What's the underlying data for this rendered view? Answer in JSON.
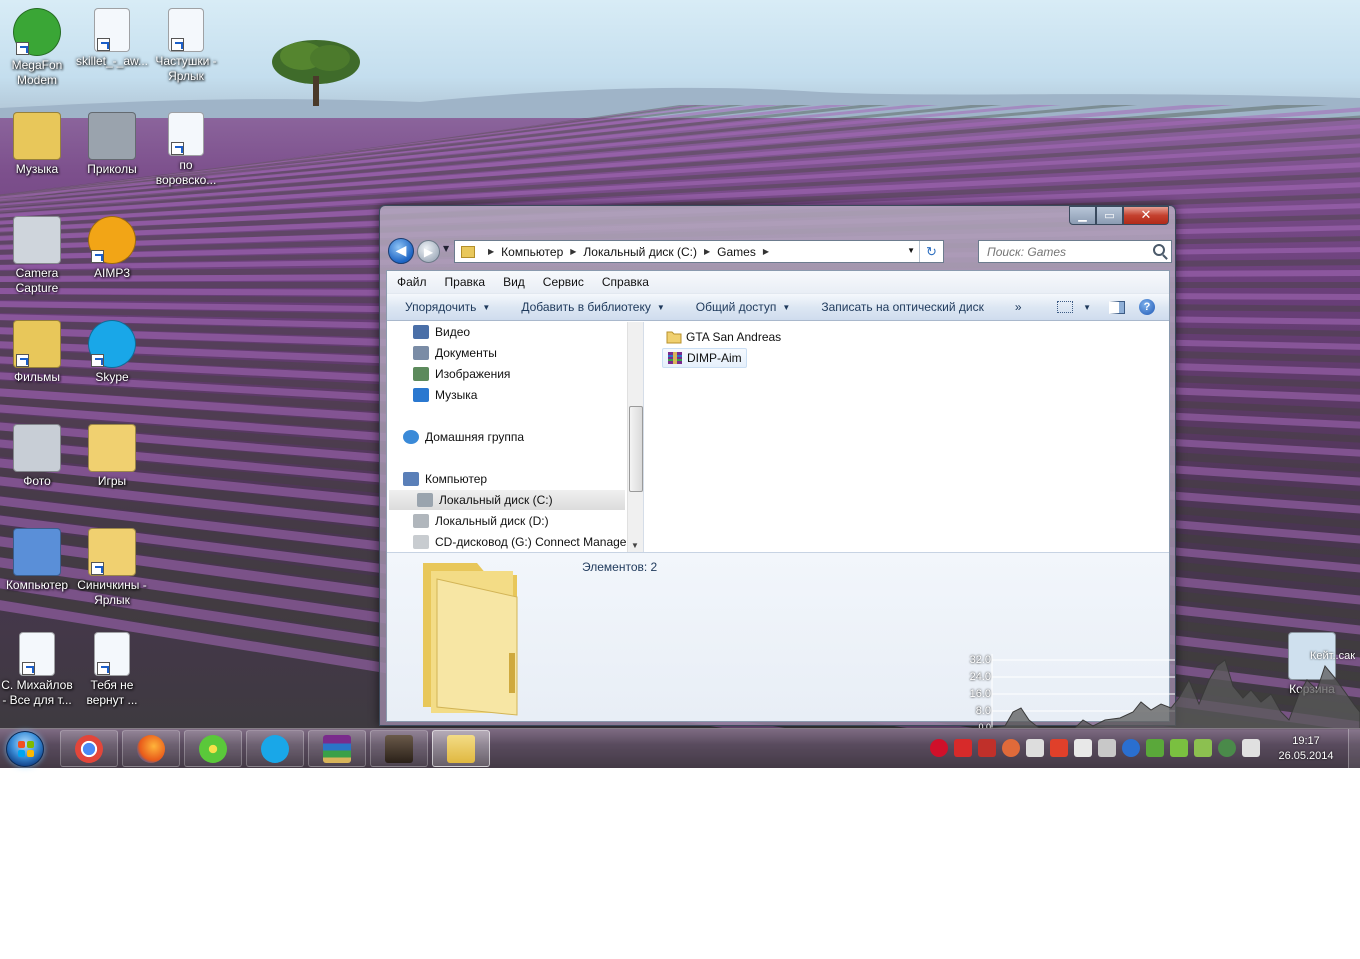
{
  "desktop": {
    "icons": [
      {
        "label": "MegaFon Modem",
        "icon": "megafon-modem-icon"
      },
      {
        "label": "skillet_-_aw...",
        "icon": "mp3-file-icon"
      },
      {
        "label": "Частушки - Ярлык",
        "icon": "mp3-file-icon"
      },
      {
        "label": "Музыка",
        "icon": "music-folder-icon"
      },
      {
        "label": "Приколы",
        "icon": "camcorder-icon"
      },
      {
        "label": "по воровско...",
        "icon": "mp3-file-icon"
      },
      {
        "label": "Camera Capture",
        "icon": "webcam-icon"
      },
      {
        "label": "AIMP3",
        "icon": "aimp-icon"
      },
      {
        "label": "Фильмы",
        "icon": "video-folder-icon"
      },
      {
        "label": "Skype",
        "icon": "skype-icon"
      },
      {
        "label": "Фото",
        "icon": "photo-camera-icon"
      },
      {
        "label": "Игры",
        "icon": "folder-icon"
      },
      {
        "label": "Компьютер",
        "icon": "computer-icon"
      },
      {
        "label": "Синичкины - Ярлык",
        "icon": "folder-icon"
      },
      {
        "label": "С. Михайлов - Все для т...",
        "icon": "mp3-file-icon"
      },
      {
        "label": "Тебя не вернут ...",
        "icon": "mp3-file-icon"
      },
      {
        "label": "Корзина",
        "icon": "recycle-bin-icon"
      }
    ],
    "recycle_overlay_text": "Кейт..сак",
    "wallpaper_accent": "#7c4f8c"
  },
  "explorer": {
    "breadcrumb": [
      "Компьютер",
      "Локальный диск (C:)",
      "Games"
    ],
    "search": {
      "placeholder": "Поиск: Games"
    },
    "menu": [
      "Файл",
      "Правка",
      "Вид",
      "Сервис",
      "Справка"
    ],
    "toolbar": {
      "organize": "Упорядочить",
      "add_to_library": "Добавить в библиотеку",
      "share": "Общий доступ",
      "burn": "Записать на оптический диск",
      "more": "»"
    },
    "nav_items": [
      {
        "label": "Видео",
        "icon": "video-library-icon"
      },
      {
        "label": "Документы",
        "icon": "documents-library-icon"
      },
      {
        "label": "Изображения",
        "icon": "pictures-library-icon"
      },
      {
        "label": "Музыка",
        "icon": "music-library-icon"
      },
      {
        "label": "Домашняя группа",
        "icon": "homegroup-icon"
      },
      {
        "label": "Компьютер",
        "icon": "computer-icon"
      },
      {
        "label": "Локальный диск (C:)",
        "icon": "system-drive-icon"
      },
      {
        "label": "Локальный диск (D:)",
        "icon": "drive-icon"
      },
      {
        "label": "CD-дисковод (G:) Connect Manage",
        "icon": "cd-drive-icon"
      }
    ],
    "files": [
      {
        "name": "GTA San Andreas",
        "icon": "folder-icon"
      },
      {
        "name": "DIMP-Aim",
        "icon": "winrar-archive-icon"
      }
    ],
    "status": "Элементов: 2",
    "controls": {
      "minimize": "▁",
      "maximize": "▭",
      "close": "✕"
    }
  },
  "netgraph": {
    "y_labels": [
      "32.0",
      "24.0",
      "16.0",
      "8.0",
      "0.0"
    ]
  },
  "taskbar": {
    "pinned": [
      {
        "app": "Google Chrome",
        "icon": "chrome-icon"
      },
      {
        "app": "Mozilla Firefox",
        "icon": "firefox-icon"
      },
      {
        "app": "ICQ",
        "icon": "icq-icon"
      },
      {
        "app": "Skype",
        "icon": "skype-icon"
      },
      {
        "app": "WinRAR",
        "icon": "winrar-icon"
      },
      {
        "app": "GTA San Andreas",
        "icon": "gta-icon"
      },
      {
        "app": "Проводник",
        "icon": "explorer-icon"
      }
    ],
    "clock": {
      "time": "19:17",
      "date": "26.05.2014"
    }
  }
}
